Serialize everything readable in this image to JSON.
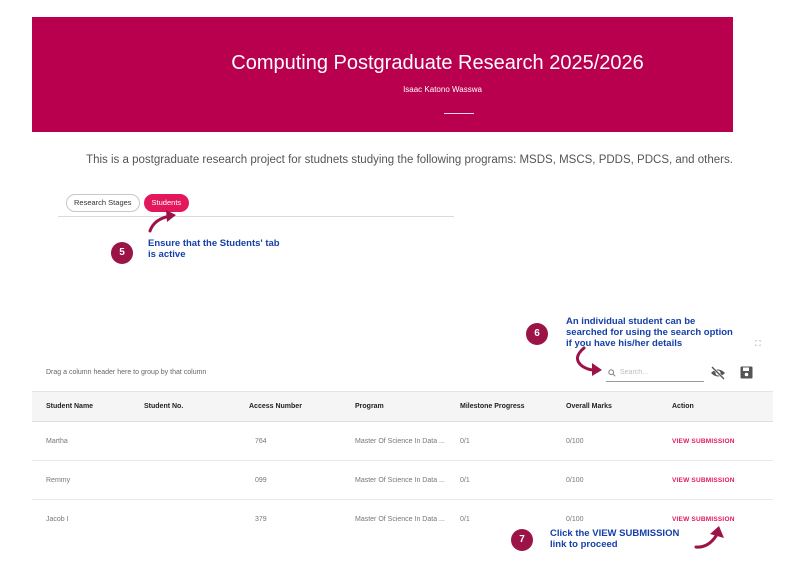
{
  "banner": {
    "title": "Computing Postgraduate Research 2025/2026",
    "subtitle": "Isaac Katono Wasswa",
    "color": "#b8004e"
  },
  "description": "This is a postgraduate research project for studnets studying the following programs: MSDS, MSCS, PDDS, PDCS, and others.",
  "tabs": [
    {
      "label": "Research Stages",
      "active": false
    },
    {
      "label": "Students",
      "active": true
    }
  ],
  "callouts": [
    {
      "number": "5",
      "text_line1": "Ensure that the Students' tab",
      "text_line2": "is active"
    },
    {
      "number": "6",
      "text_line1": "An individual student can be",
      "text_line2": "searched for using the search option",
      "text_line3": "if you have his/her details"
    },
    {
      "number": "7",
      "text_line1": "Click the VIEW SUBMISSION",
      "text_line2": "link to proceed"
    }
  ],
  "grid": {
    "group_hint": "Drag a column header here to group by that column",
    "search_placeholder": "Search...",
    "columns": [
      "Student Name",
      "Student No.",
      "Access Number",
      "Program",
      "Milestone Progress",
      "Overall Marks",
      "Action"
    ],
    "rows": [
      {
        "name": "Martha",
        "student_no": "",
        "access": "764",
        "program": "Master Of Science In Data ...",
        "milestone": "0/1",
        "marks": "0/100",
        "action": "VIEW SUBMISSION"
      },
      {
        "name": "Remmy",
        "student_no": "",
        "access": "099",
        "program": "Master Of Science In Data ...",
        "milestone": "0/1",
        "marks": "0/100",
        "action": "VIEW SUBMISSION"
      },
      {
        "name": "Jacob I",
        "student_no": "",
        "access": "379",
        "program": "Master Of Science In Data ...",
        "milestone": "0/1",
        "marks": "0/100",
        "action": "VIEW SUBMISSION"
      }
    ]
  },
  "colors": {
    "accent": "#e3185c",
    "callout_text": "#1540a8",
    "badge": "#9c1447"
  }
}
